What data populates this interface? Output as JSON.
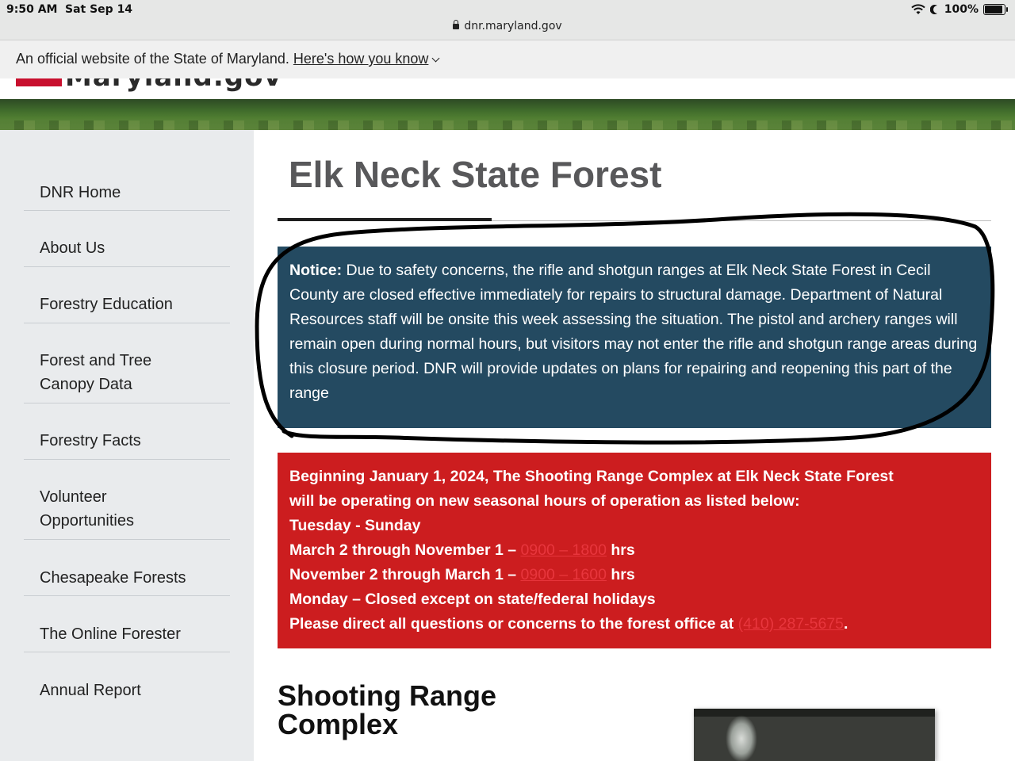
{
  "status_bar": {
    "time": "9:50 AM",
    "date": "Sat Sep 14",
    "battery": "100%",
    "battery_level": 1.0,
    "url": "dnr.maryland.gov",
    "icons": [
      "wifi-icon",
      "moon-icon",
      "battery-icon",
      "lock-icon"
    ]
  },
  "official_banner": {
    "text": "An official website of the State of Maryland.",
    "link": "Here's how you know"
  },
  "header": {
    "logo_text": "Maryland.gov"
  },
  "sidebar": {
    "items": [
      {
        "label": "DNR Home"
      },
      {
        "label": "About Us"
      },
      {
        "label": "Forestry Education"
      },
      {
        "label": "Forest and Tree Canopy Data"
      },
      {
        "label": "Forestry Facts"
      },
      {
        "label": "Volunteer Opportunities"
      },
      {
        "label": "Chesapeake Forests"
      },
      {
        "label": "The Online Forester"
      },
      {
        "label": "Annual Report"
      }
    ]
  },
  "main": {
    "title": "Elk Neck State Forest",
    "notice": {
      "label": "Notice:",
      "text": "Due to safety concerns, the rifle and shotgun ranges at Elk Neck State Forest in Cecil County are closed effective immediately for repairs to structural damage. Department of Natural Resources staff will be onsite this week assessing the situation. The pistol and archery ranges will remain open during normal hours, but visitors may not enter the rifle and shotgun range areas during this closure period. DNR will provide updates on plans for repairing and reopening this part of the range"
    },
    "hours": {
      "intro_1": "Beginning January 1, 2024, The Shooting Range Complex at Elk Neck State Forest",
      "intro_2": "will be operating on new seasonal hours of operation as listed below:",
      "days": "Tuesday - Sunday",
      "season1_label": "March 2 through November 1 –",
      "season1_hours": "0900 – 1800",
      "season2_label": "November 2 through March 1 –",
      "season2_hours": "0900 – 1600",
      "hrs": "hrs",
      "monday": "Monday – Closed except on state/federal holidays",
      "contact": "Please direct all questions or concerns to the forest office at",
      "phone": "(410) 287-5675",
      "period": "."
    },
    "section_title_1": "Shooting Range",
    "section_title_2": "Complex"
  },
  "colors": {
    "notice_bg": "#244a61",
    "hours_bg": "#cc1d1f",
    "link_red": "#e8363d",
    "sidebar_bg": "#e9ebed",
    "title_gray": "#58585a"
  }
}
